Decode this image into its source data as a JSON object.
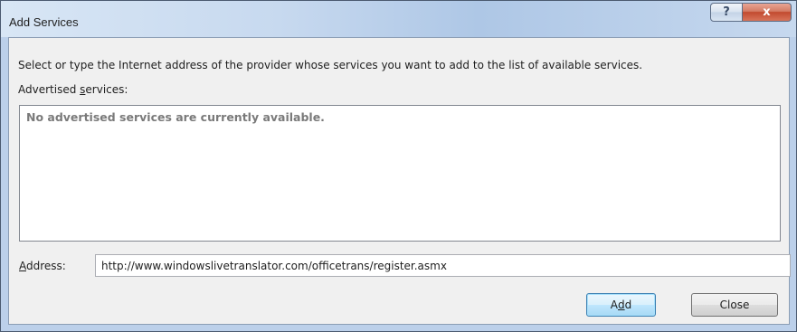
{
  "window": {
    "title": "Add Services",
    "help_glyph": "?",
    "close_glyph": "x"
  },
  "dialog": {
    "instructions": "Select or type the Internet address of the provider whose services you want to add to the list of available services.",
    "advertised_label_pre": "Advertised ",
    "advertised_label_access": "s",
    "advertised_label_post": "ervices:",
    "empty_message": "No advertised services are currently available.",
    "address_label_access": "A",
    "address_label_post": "ddress:",
    "address_value": "http://www.windowslivetranslator.com/officetrans/register.asmx"
  },
  "buttons": {
    "add_pre": "A",
    "add_access": "d",
    "add_post": "d",
    "close_label": "Close"
  }
}
